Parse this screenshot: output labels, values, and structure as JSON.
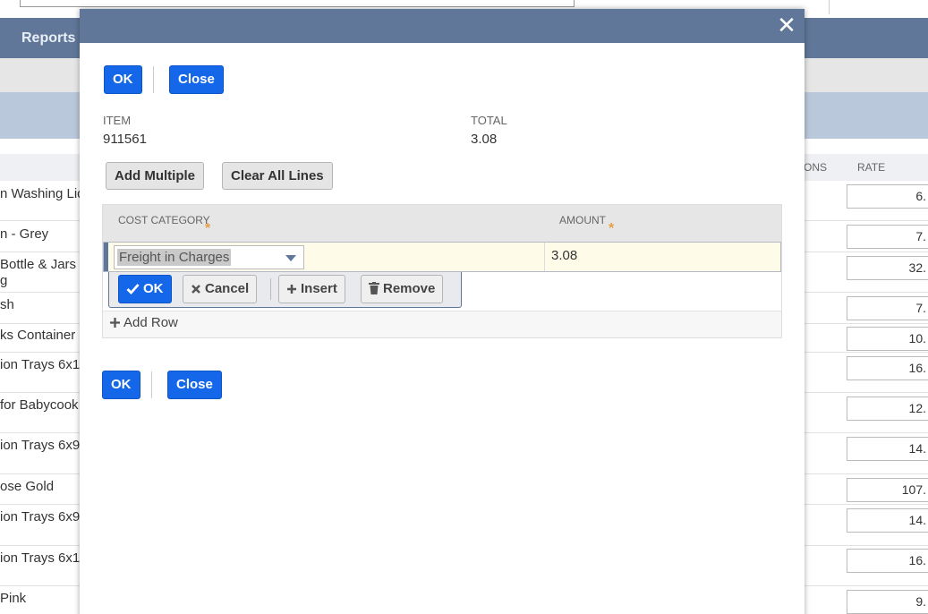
{
  "background": {
    "nav_label": "Reports",
    "columns": {
      "options_partial": "ONS",
      "rate": "RATE"
    },
    "rows": [
      {
        "text": "n Washing Liq",
        "rate": "6."
      },
      {
        "text": "n - Grey",
        "rate": "7."
      },
      {
        "text": "Bottle & Jars",
        "text2": "g",
        "rate": "32."
      },
      {
        "text": "sh",
        "rate": "7."
      },
      {
        "text": "ks Container",
        "rate": "10."
      },
      {
        "text": "ion Trays 6x1",
        "rate": "16."
      },
      {
        "text": "for Babycook",
        "rate": "12."
      },
      {
        "text": "ion Trays 6x9",
        "rate": "14."
      },
      {
        "text": "ose Gold",
        "rate": "107."
      },
      {
        "text": "ion Trays 6x9",
        "rate": "14."
      },
      {
        "text": "ion Trays 6x1",
        "rate": "16."
      },
      {
        "text": "Pink",
        "rate": "9."
      }
    ]
  },
  "modal": {
    "close_icon": "close-icon",
    "top_actions": {
      "ok": "OK",
      "close": "Close"
    },
    "fields": {
      "item_label": "ITEM",
      "item_value": "911561",
      "total_label": "TOTAL",
      "total_value": "3.08"
    },
    "buttons": {
      "add_multiple": "Add Multiple",
      "clear_all_lines": "Clear All Lines"
    },
    "grid": {
      "columns": {
        "cost_category": "COST CATEGORY",
        "amount": "AMOUNT"
      },
      "required_mark": "*",
      "rows": [
        {
          "cost_category": "Freight in Charges",
          "amount": "3.08"
        }
      ],
      "row_actions": {
        "ok": "OK",
        "cancel": "Cancel",
        "insert": "Insert",
        "remove": "Remove"
      },
      "add_row": "Add Row"
    },
    "bottom_actions": {
      "ok": "OK",
      "close": "Close"
    }
  },
  "colors": {
    "header_blue": "#607799",
    "primary_button": "#1467e8",
    "required_mark": "#e5a04a",
    "edit_row_bg": "#fefce8"
  }
}
